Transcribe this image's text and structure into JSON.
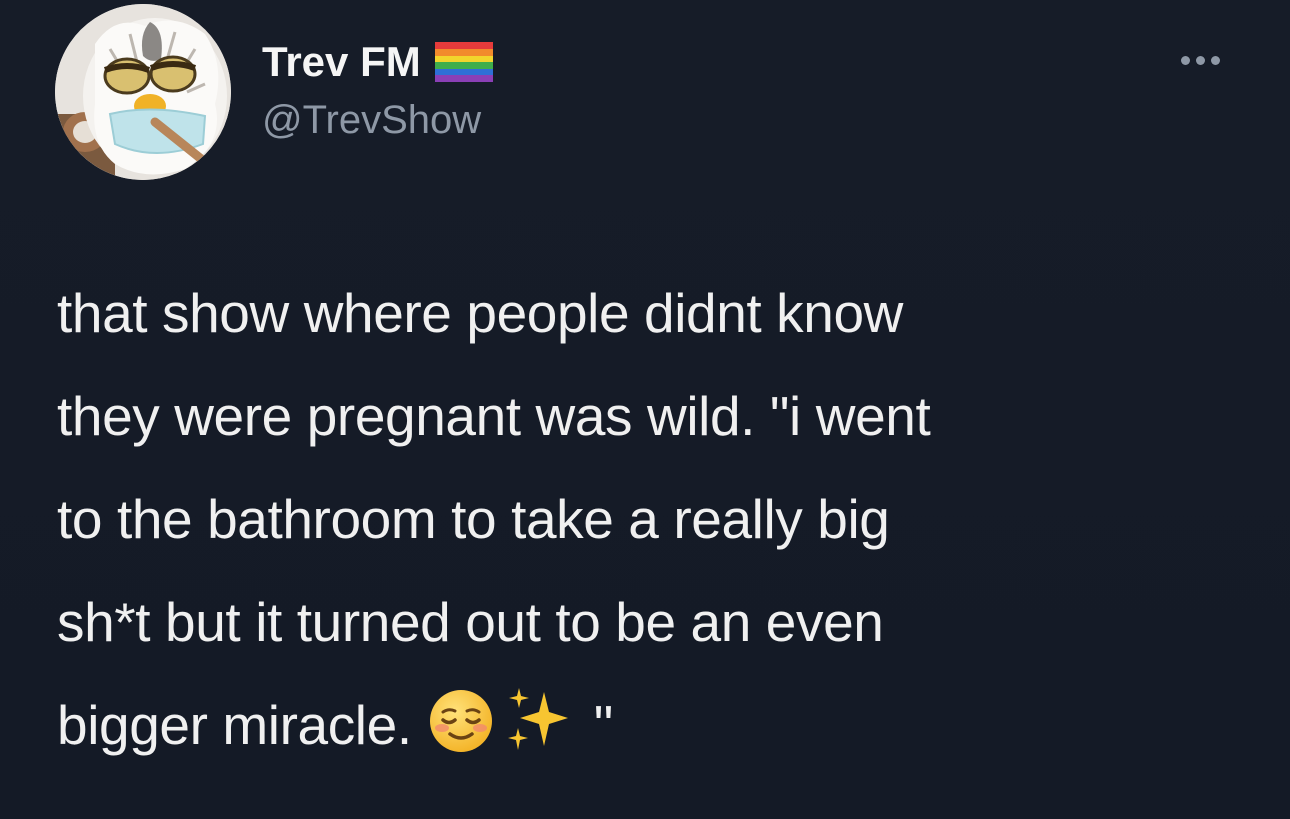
{
  "user": {
    "display_name": "Trev FM",
    "handle": "@TrevShow",
    "name_badge_icon": "rainbow-flag-icon",
    "avatar_icon": "furby-avatar"
  },
  "menu": {
    "more_icon": "ellipsis-icon"
  },
  "tweet": {
    "lines": [
      "that show where people didnt know",
      "they were pregnant was wild. \"i went",
      "to the bathroom to take a really big",
      "sh*t but it turned out to be an even",
      "bigger miracle."
    ],
    "closing_quote": "\"",
    "emojis": [
      "smiling-face-icon",
      "sparkles-icon"
    ]
  },
  "colors": {
    "background": "#151b27",
    "text_primary": "#f0f0f0",
    "text_secondary": "#8e98a6"
  }
}
